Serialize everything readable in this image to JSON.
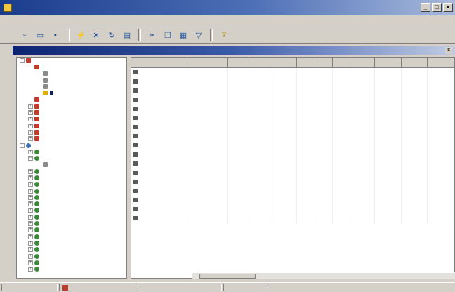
{
  "window": {
    "title": "",
    "buttons": {
      "minimize": "_",
      "maximize": "□",
      "close": "×"
    }
  },
  "menu": {
    "items": [
      "",
      "",
      "",
      "",
      "",
      ""
    ]
  },
  "toolbar": {
    "icons": [
      "new-icon",
      "open-icon",
      "save-icon",
      "connect-icon",
      "disconnect-icon",
      "refresh-icon",
      "properties-icon",
      "cut-icon",
      "copy-icon",
      "paste-icon",
      "filter-icon",
      "help-icon"
    ],
    "help_glyph": "?"
  },
  "child_window": {
    "title": "",
    "close": "×"
  },
  "tree": {
    "items": [
      {
        "label": "",
        "level": 0,
        "icon": "server",
        "expander": "−"
      },
      {
        "label": "",
        "level": 1,
        "icon": "server",
        "expander": ""
      },
      {
        "label": "",
        "level": 2,
        "icon": "table",
        "expander": ""
      },
      {
        "label": "",
        "level": 2,
        "icon": "table",
        "expander": ""
      },
      {
        "label": "",
        "level": 2,
        "icon": "table",
        "expander": ""
      },
      {
        "label": "",
        "level": 2,
        "icon": "active",
        "expander": "",
        "selected": true
      },
      {
        "label": "",
        "level": 1,
        "icon": "server",
        "expander": ""
      },
      {
        "label": "",
        "level": 1,
        "icon": "server",
        "expander": "+"
      },
      {
        "label": "",
        "level": 1,
        "icon": "server",
        "expander": "+"
      },
      {
        "label": "",
        "level": 1,
        "icon": "server",
        "expander": "+"
      },
      {
        "label": "",
        "level": 1,
        "icon": "server",
        "expander": "+"
      },
      {
        "label": "",
        "level": 1,
        "icon": "server",
        "expander": "+"
      },
      {
        "label": "",
        "level": 1,
        "icon": "server",
        "expander": "+"
      },
      {
        "label": "",
        "level": 0,
        "icon": "db",
        "expander": "−"
      },
      {
        "label": "",
        "level": 1,
        "icon": "user",
        "expander": "+"
      },
      {
        "label": "",
        "level": 1,
        "icon": "user",
        "expander": "−"
      },
      {
        "label": "",
        "level": 2,
        "icon": "table",
        "expander": ""
      },
      {
        "label": "",
        "level": 1,
        "icon": "user",
        "expander": "+"
      },
      {
        "label": "",
        "level": 1,
        "icon": "user",
        "expander": "+"
      },
      {
        "label": "",
        "level": 1,
        "icon": "user",
        "expander": "+"
      },
      {
        "label": "",
        "level": 1,
        "icon": "user",
        "expander": "+"
      },
      {
        "label": "",
        "level": 1,
        "icon": "user",
        "expander": "+"
      },
      {
        "label": "",
        "level": 1,
        "icon": "user",
        "expander": "+"
      },
      {
        "label": "",
        "level": 1,
        "icon": "user",
        "expander": "+"
      },
      {
        "label": "",
        "level": 1,
        "icon": "user",
        "expander": "+"
      },
      {
        "label": "",
        "level": 1,
        "icon": "user",
        "expander": "+"
      },
      {
        "label": "",
        "level": 1,
        "icon": "user",
        "expander": "+"
      },
      {
        "label": "",
        "level": 1,
        "icon": "user",
        "expander": "+"
      },
      {
        "label": "",
        "level": 1,
        "icon": "user",
        "expander": "+"
      },
      {
        "label": "",
        "level": 1,
        "icon": "user",
        "expander": "+"
      },
      {
        "label": "",
        "level": 1,
        "icon": "user",
        "expander": "+"
      },
      {
        "label": "",
        "level": 1,
        "icon": "user",
        "expander": "+"
      },
      {
        "label": "",
        "level": 1,
        "icon": "user",
        "expander": "+"
      }
    ]
  },
  "grid": {
    "columns": [
      "",
      "",
      "",
      "",
      "",
      "",
      "",
      "",
      "",
      "",
      "",
      ""
    ],
    "rows": [
      {
        "strong": true,
        "cells": [
          "",
          "",
          "",
          "",
          "",
          "",
          "",
          "",
          "",
          "",
          "",
          ""
        ]
      },
      {
        "strong": false,
        "cells": [
          "",
          "",
          "",
          "",
          "",
          "",
          "",
          "",
          "",
          "",
          "",
          ""
        ]
      },
      {
        "strong": false,
        "cells": [
          "",
          "",
          "",
          "",
          "",
          "",
          "",
          "",
          "",
          "",
          "",
          ""
        ]
      },
      {
        "strong": false,
        "cells": [
          "",
          "",
          "",
          "",
          "",
          "",
          "",
          "",
          "",
          "",
          "",
          ""
        ]
      },
      {
        "strong": true,
        "cells": [
          "",
          "",
          "",
          "",
          "",
          "",
          "",
          "",
          "",
          "",
          "",
          ""
        ]
      },
      {
        "strong": false,
        "cells": [
          "",
          "",
          "",
          "",
          "",
          "",
          "",
          "",
          "",
          "",
          "",
          ""
        ]
      },
      {
        "strong": false,
        "cells": [
          "",
          "",
          "",
          "",
          "",
          "",
          "",
          "",
          "",
          "",
          "",
          ""
        ]
      },
      {
        "strong": false,
        "cells": [
          "",
          "",
          "",
          "",
          "",
          "",
          "",
          "",
          "",
          "",
          "",
          ""
        ]
      },
      {
        "strong": true,
        "cells": [
          "",
          "",
          "",
          "",
          "",
          "",
          "",
          "",
          "",
          "",
          "",
          ""
        ]
      },
      {
        "strong": false,
        "cells": [
          "",
          "",
          "",
          "",
          "",
          "",
          "",
          "",
          "",
          "",
          "",
          ""
        ]
      },
      {
        "strong": false,
        "cells": [
          "",
          "",
          "",
          "",
          "",
          "",
          "",
          "",
          "",
          "",
          "",
          ""
        ]
      },
      {
        "strong": false,
        "cells": [
          "",
          "",
          "",
          "",
          "",
          "",
          "",
          "",
          "",
          "",
          "",
          ""
        ]
      },
      {
        "strong": true,
        "cells": [
          "",
          "",
          "",
          "",
          "",
          "",
          "",
          "",
          "",
          "",
          "",
          ""
        ]
      },
      {
        "strong": false,
        "cells": [
          "",
          "",
          "",
          "",
          "",
          "",
          "",
          "",
          "",
          "",
          "",
          ""
        ]
      },
      {
        "strong": false,
        "cells": [
          "",
          "",
          "",
          "",
          "",
          "",
          "",
          "",
          "",
          "",
          "",
          ""
        ]
      },
      {
        "strong": false,
        "cells": [
          "",
          "",
          "",
          "",
          "",
          "",
          "",
          "",
          "",
          "",
          "",
          ""
        ]
      },
      {
        "strong": true,
        "cells": [
          "",
          "",
          "",
          "",
          "",
          "",
          "",
          "",
          "",
          "",
          "",
          ""
        ]
      }
    ]
  },
  "status": {
    "panes": [
      "",
      "",
      "",
      ""
    ]
  }
}
